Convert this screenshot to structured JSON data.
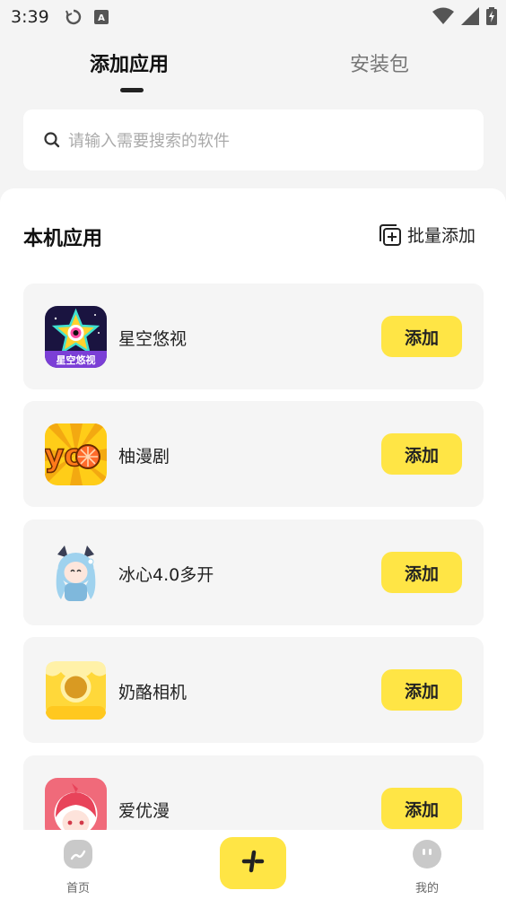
{
  "status_bar": {
    "time": "3:39"
  },
  "tabs": [
    {
      "label": "添加应用",
      "active": true
    },
    {
      "label": "安装包",
      "active": false
    }
  ],
  "search": {
    "placeholder": "请输入需要搜索的软件",
    "value": ""
  },
  "section": {
    "title": "本机应用",
    "batch_add_label": "批量添加"
  },
  "apps": [
    {
      "name": "星空悠视",
      "button": "添加",
      "icon": "star-app-icon",
      "icon_text": "星空悠视"
    },
    {
      "name": "柚漫剧",
      "button": "添加",
      "icon": "yo-app-icon",
      "icon_text": "yo"
    },
    {
      "name": "冰心4.0多开",
      "button": "添加",
      "icon": "anime-girl-app-icon"
    },
    {
      "name": "奶酪相机",
      "button": "添加",
      "icon": "cheese-camera-icon"
    },
    {
      "name": "爱优漫",
      "button": "添加",
      "icon": "anime-red-hair-icon"
    }
  ],
  "bottom_nav": {
    "home_label": "首页",
    "center_icon": "plus-icon",
    "me_label": "我的"
  },
  "colors": {
    "accent": "#ffe545",
    "background": "#f4f4f4"
  }
}
